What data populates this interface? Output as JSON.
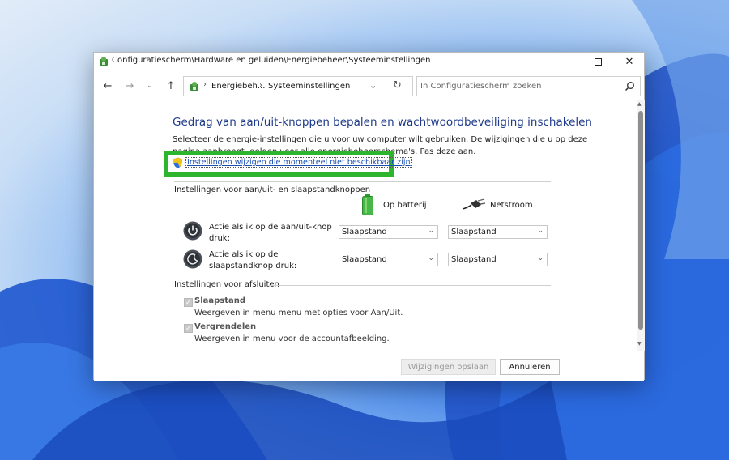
{
  "window": {
    "title": "Configuratiescherm\\Hardware en geluiden\\Energiebeheer\\Systeeminstellingen"
  },
  "navbar": {
    "breadcrumb_1": "Energiebeh...",
    "breadcrumb_2": "Systeeminstellingen",
    "search_placeholder": "In Configuratiescherm zoeken"
  },
  "main": {
    "title": "Gedrag van aan/uit-knoppen bepalen en wachtwoordbeveiliging inschakelen",
    "description_line1": "Selecteer de energie-instellingen die u voor uw computer wilt gebruiken. De wijzigingen die u op deze",
    "description_line2": "pagina aanbrengt, gelden voor alle energiebeheerschema's. Pas deze aan.",
    "change_link": "Instellingen wijzigen die momenteel niet beschikbaar zijn",
    "buttons_section": "Instellingen voor aan/uit- en slaapstandknoppen",
    "col_battery": "Op batterij",
    "col_mains": "Netstroom",
    "rows": [
      {
        "label": "Actie als ik op de aan/uit-knop druk:",
        "battery": "Slaapstand",
        "mains": "Slaapstand"
      },
      {
        "label": "Actie als ik op de slaapstandknop druk:",
        "battery": "Slaapstand",
        "mains": "Slaapstand"
      }
    ],
    "shutdown_section": "Instellingen voor afsluiten",
    "options": [
      {
        "title": "Slaapstand",
        "desc": "Weergeven in menu menu met opties voor Aan/Uit.",
        "checked": true
      },
      {
        "title": "Vergrendelen",
        "desc": "Weergeven in menu voor de accountafbeelding.",
        "checked": true
      }
    ]
  },
  "footer": {
    "save_label": "Wijzigingen opslaan",
    "cancel_label": "Annuleren"
  },
  "colors": {
    "highlight": "#2eb52e",
    "title_blue": "#1e3a8a",
    "link_blue": "#1a4fb3"
  }
}
